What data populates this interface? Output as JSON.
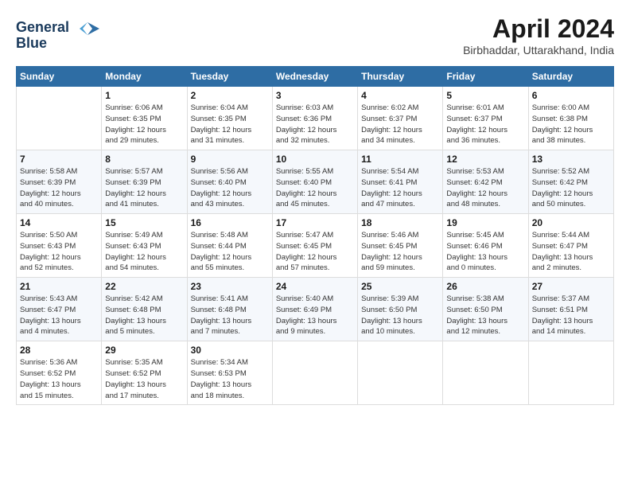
{
  "header": {
    "logo_line1": "General",
    "logo_line2": "Blue",
    "month": "April 2024",
    "location": "Birbhaddar, Uttarakhand, India"
  },
  "days_of_week": [
    "Sunday",
    "Monday",
    "Tuesday",
    "Wednesday",
    "Thursday",
    "Friday",
    "Saturday"
  ],
  "weeks": [
    [
      {
        "day": "",
        "info": ""
      },
      {
        "day": "1",
        "info": "Sunrise: 6:06 AM\nSunset: 6:35 PM\nDaylight: 12 hours\nand 29 minutes."
      },
      {
        "day": "2",
        "info": "Sunrise: 6:04 AM\nSunset: 6:35 PM\nDaylight: 12 hours\nand 31 minutes."
      },
      {
        "day": "3",
        "info": "Sunrise: 6:03 AM\nSunset: 6:36 PM\nDaylight: 12 hours\nand 32 minutes."
      },
      {
        "day": "4",
        "info": "Sunrise: 6:02 AM\nSunset: 6:37 PM\nDaylight: 12 hours\nand 34 minutes."
      },
      {
        "day": "5",
        "info": "Sunrise: 6:01 AM\nSunset: 6:37 PM\nDaylight: 12 hours\nand 36 minutes."
      },
      {
        "day": "6",
        "info": "Sunrise: 6:00 AM\nSunset: 6:38 PM\nDaylight: 12 hours\nand 38 minutes."
      }
    ],
    [
      {
        "day": "7",
        "info": "Sunrise: 5:58 AM\nSunset: 6:39 PM\nDaylight: 12 hours\nand 40 minutes."
      },
      {
        "day": "8",
        "info": "Sunrise: 5:57 AM\nSunset: 6:39 PM\nDaylight: 12 hours\nand 41 minutes."
      },
      {
        "day": "9",
        "info": "Sunrise: 5:56 AM\nSunset: 6:40 PM\nDaylight: 12 hours\nand 43 minutes."
      },
      {
        "day": "10",
        "info": "Sunrise: 5:55 AM\nSunset: 6:40 PM\nDaylight: 12 hours\nand 45 minutes."
      },
      {
        "day": "11",
        "info": "Sunrise: 5:54 AM\nSunset: 6:41 PM\nDaylight: 12 hours\nand 47 minutes."
      },
      {
        "day": "12",
        "info": "Sunrise: 5:53 AM\nSunset: 6:42 PM\nDaylight: 12 hours\nand 48 minutes."
      },
      {
        "day": "13",
        "info": "Sunrise: 5:52 AM\nSunset: 6:42 PM\nDaylight: 12 hours\nand 50 minutes."
      }
    ],
    [
      {
        "day": "14",
        "info": "Sunrise: 5:50 AM\nSunset: 6:43 PM\nDaylight: 12 hours\nand 52 minutes."
      },
      {
        "day": "15",
        "info": "Sunrise: 5:49 AM\nSunset: 6:43 PM\nDaylight: 12 hours\nand 54 minutes."
      },
      {
        "day": "16",
        "info": "Sunrise: 5:48 AM\nSunset: 6:44 PM\nDaylight: 12 hours\nand 55 minutes."
      },
      {
        "day": "17",
        "info": "Sunrise: 5:47 AM\nSunset: 6:45 PM\nDaylight: 12 hours\nand 57 minutes."
      },
      {
        "day": "18",
        "info": "Sunrise: 5:46 AM\nSunset: 6:45 PM\nDaylight: 12 hours\nand 59 minutes."
      },
      {
        "day": "19",
        "info": "Sunrise: 5:45 AM\nSunset: 6:46 PM\nDaylight: 13 hours\nand 0 minutes."
      },
      {
        "day": "20",
        "info": "Sunrise: 5:44 AM\nSunset: 6:47 PM\nDaylight: 13 hours\nand 2 minutes."
      }
    ],
    [
      {
        "day": "21",
        "info": "Sunrise: 5:43 AM\nSunset: 6:47 PM\nDaylight: 13 hours\nand 4 minutes."
      },
      {
        "day": "22",
        "info": "Sunrise: 5:42 AM\nSunset: 6:48 PM\nDaylight: 13 hours\nand 5 minutes."
      },
      {
        "day": "23",
        "info": "Sunrise: 5:41 AM\nSunset: 6:48 PM\nDaylight: 13 hours\nand 7 minutes."
      },
      {
        "day": "24",
        "info": "Sunrise: 5:40 AM\nSunset: 6:49 PM\nDaylight: 13 hours\nand 9 minutes."
      },
      {
        "day": "25",
        "info": "Sunrise: 5:39 AM\nSunset: 6:50 PM\nDaylight: 13 hours\nand 10 minutes."
      },
      {
        "day": "26",
        "info": "Sunrise: 5:38 AM\nSunset: 6:50 PM\nDaylight: 13 hours\nand 12 minutes."
      },
      {
        "day": "27",
        "info": "Sunrise: 5:37 AM\nSunset: 6:51 PM\nDaylight: 13 hours\nand 14 minutes."
      }
    ],
    [
      {
        "day": "28",
        "info": "Sunrise: 5:36 AM\nSunset: 6:52 PM\nDaylight: 13 hours\nand 15 minutes."
      },
      {
        "day": "29",
        "info": "Sunrise: 5:35 AM\nSunset: 6:52 PM\nDaylight: 13 hours\nand 17 minutes."
      },
      {
        "day": "30",
        "info": "Sunrise: 5:34 AM\nSunset: 6:53 PM\nDaylight: 13 hours\nand 18 minutes."
      },
      {
        "day": "",
        "info": ""
      },
      {
        "day": "",
        "info": ""
      },
      {
        "day": "",
        "info": ""
      },
      {
        "day": "",
        "info": ""
      }
    ]
  ]
}
